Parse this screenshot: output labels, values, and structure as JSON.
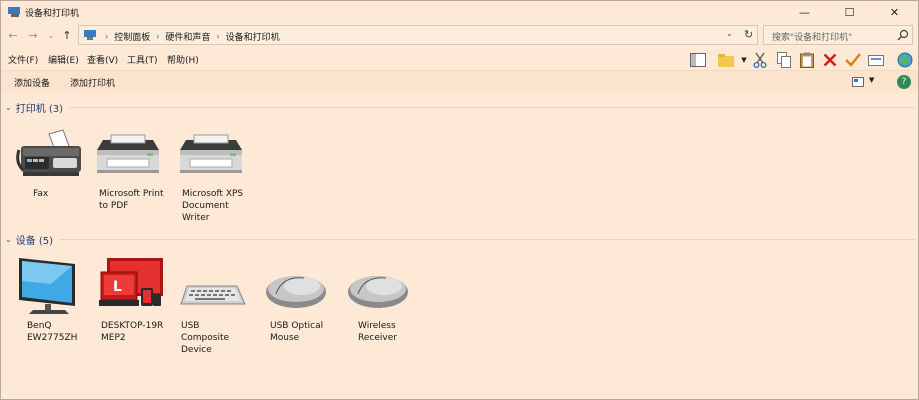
{
  "window": {
    "title": "设备和打印机",
    "controls": {
      "minimize": "—",
      "maximize": "☐",
      "close": "✕"
    }
  },
  "address": {
    "crumbs": [
      "控制面板",
      "硬件和声音",
      "设备和打印机"
    ],
    "search_placeholder": "搜索\"设备和打印机\""
  },
  "menu": {
    "items": [
      "文件(F)",
      "编辑(E)",
      "查看(V)",
      "工具(T)",
      "帮助(H)"
    ]
  },
  "commands": {
    "add_device": "添加设备",
    "add_printer": "添加打印机"
  },
  "groups": {
    "printers": {
      "title": "打印机 (3)",
      "items": [
        {
          "label": "Fax",
          "icon": "fax-icon"
        },
        {
          "label": "Microsoft Print to PDF",
          "icon": "printer-icon"
        },
        {
          "label": "Microsoft XPS Document Writer",
          "icon": "printer-icon"
        }
      ]
    },
    "devices": {
      "title": "设备 (5)",
      "items": [
        {
          "label": "BenQ EW2775ZH",
          "icon": "monitor-icon"
        },
        {
          "label": "DESKTOP-19R MEP2",
          "icon": "computer-icon"
        },
        {
          "label": "USB Composite Device",
          "icon": "keyboard-icon"
        },
        {
          "label": "USB Optical Mouse",
          "icon": "mouse-icon"
        },
        {
          "label": "Wireless Receiver",
          "icon": "mouse-icon"
        }
      ]
    }
  },
  "colors": {
    "background": "#fde9d6",
    "group_title": "#1f3d7a",
    "delete_red": "#d61f1f",
    "check_orange": "#e07b12"
  }
}
